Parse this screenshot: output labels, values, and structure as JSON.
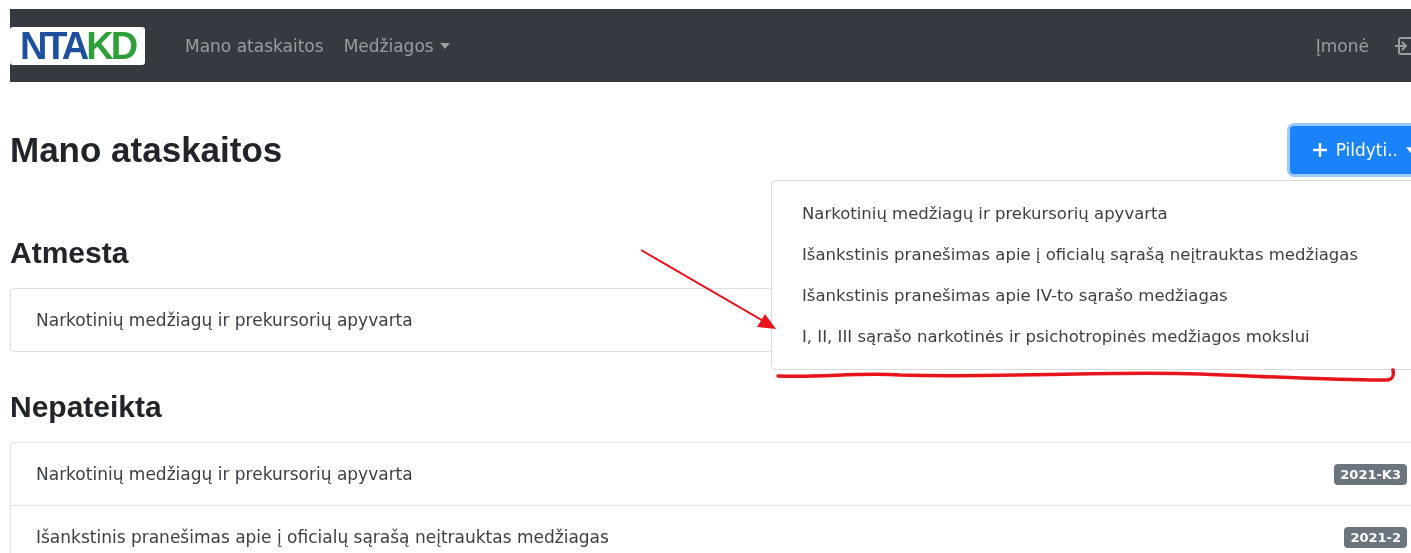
{
  "navbar": {
    "logo": [
      {
        "text": "NTA",
        "color": "#1d4f9c"
      },
      {
        "text": "KD",
        "color": "#2ea03a"
      }
    ],
    "links": [
      {
        "label": "Mano ataskaitos",
        "dropdown": false
      },
      {
        "label": "Medžiagos",
        "dropdown": true
      }
    ],
    "user": "Įmonė"
  },
  "page_title": "Mano ataskaitos",
  "add_button": {
    "label": "Pildyti..",
    "expanded": true,
    "menu": [
      "Narkotinių medžiagų ir prekursorių apyvarta",
      "Išankstinis pranešimas apie į oficialų sąrašą neįtrauktas medžiagas",
      "Išankstinis pranešimas apie IV-to sąrašo medžiagas",
      "I, II, III sąrašo narkotinės ir psichotropinės medžiagos mokslui"
    ]
  },
  "sections": [
    {
      "title": "Atmesta",
      "rows": [
        {
          "text": "Narkotinių medžiagų ir prekursorių apyvarta"
        }
      ]
    },
    {
      "title": "Nepateikta",
      "rows": [
        {
          "text": "Narkotinių medžiagų ir prekursorių apyvarta",
          "badge": "2021-K3"
        },
        {
          "text": "Išankstinis pranešimas apie į oficialų sąrašą neįtrauktas medžiagas",
          "badge": "2021-2"
        }
      ]
    }
  ],
  "annotations": {
    "arrow": {
      "color": "#e8141c"
    },
    "underline": {
      "color": "#e8141c"
    }
  }
}
